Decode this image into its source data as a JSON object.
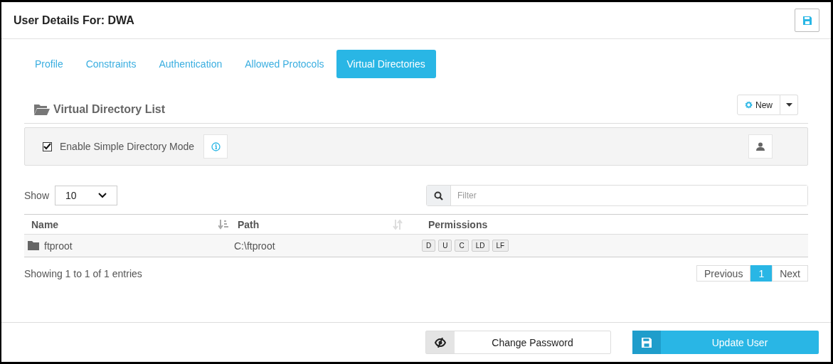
{
  "window": {
    "title": "User Details For: DWA"
  },
  "tabs": [
    {
      "label": "Profile",
      "selected": false
    },
    {
      "label": "Constraints",
      "selected": false
    },
    {
      "label": "Authentication",
      "selected": false
    },
    {
      "label": "Allowed Protocols",
      "selected": false
    },
    {
      "label": "Virtual Directories",
      "selected": true
    }
  ],
  "section": {
    "title": "Virtual Directory List",
    "new_button": "New"
  },
  "simple_mode": {
    "label": "Enable Simple Directory Mode",
    "checked": true
  },
  "show": {
    "label": "Show",
    "value": "10"
  },
  "filter": {
    "placeholder": "Filter"
  },
  "table": {
    "columns": [
      "Name",
      "Path",
      "Permissions"
    ],
    "rows": [
      {
        "name": "ftproot",
        "path": "C:\\ftproot",
        "permissions": [
          "D",
          "U",
          "C",
          "LD",
          "LF"
        ]
      }
    ]
  },
  "info": "Showing 1 to 1 of 1 entries",
  "pagination": {
    "previous": "Previous",
    "pages": [
      {
        "label": "1",
        "selected": true
      }
    ],
    "next": "Next"
  },
  "footer": {
    "change_password": "Change Password",
    "update_user": "Update User"
  }
}
